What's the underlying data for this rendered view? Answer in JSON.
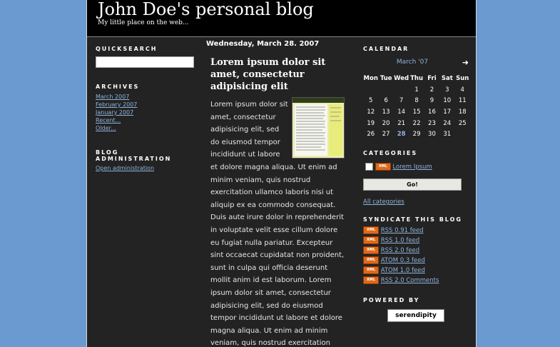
{
  "header": {
    "title": "John Doe's personal blog",
    "description": "My little place on the web..."
  },
  "left": {
    "quicksearch_title": "QUICKSEARCH",
    "archives_title": "ARCHIVES",
    "archives": [
      "March 2007",
      "February 2007",
      "January 2007",
      "Recent...",
      "Older..."
    ],
    "admin_title": "BLOG ADMINISTRATION",
    "admin_link": "Open administration"
  },
  "entry": {
    "date": "Wednesday, March 28. 2007",
    "title": "Lorem ipsum dolor sit amet, consectetur adipisicing elit",
    "body": "Lorem ipsum dolor sit amet, consectetur adipisicing elit, sed do eiusmod tempor incididunt ut labore et dolore magna aliqua. Ut enim ad minim veniam, quis nostrud exercitation ullamco laboris nisi ut aliquip ex ea commodo consequat. Duis aute irure dolor in reprehenderit in voluptate velit esse cillum dolore eu fugiat nulla pariatur. Excepteur sint occaecat cupidatat non proident, sunt in culpa qui officia deserunt mollit anim id est laborum. Lorem ipsum dolor sit amet, consectetur adipisicing elit, sed do eiusmod tempor incididunt ut labore et dolore magna aliqua. Ut enim ad minim veniam, quis nostrud exercitation ullamco laboris nisi ut aliquip ex ea"
  },
  "calendar": {
    "title": "CALENDAR",
    "month": "March '07",
    "next": "➜",
    "days": [
      "Mon",
      "Tue",
      "Wed",
      "Thu",
      "Fri",
      "Sat",
      "Sun"
    ],
    "weeks": [
      [
        "",
        "",
        "",
        "1",
        "2",
        "3",
        "4"
      ],
      [
        "5",
        "6",
        "7",
        "8",
        "9",
        "10",
        "11"
      ],
      [
        "12",
        "13",
        "14",
        "15",
        "16",
        "17",
        "18"
      ],
      [
        "19",
        "20",
        "21",
        "22",
        "23",
        "24",
        "25"
      ],
      [
        "26",
        "27",
        "28",
        "29",
        "30",
        "31",
        ""
      ]
    ],
    "today": "28"
  },
  "categories": {
    "title": "CATEGORIES",
    "items": [
      "Lorem Ipsum"
    ],
    "go_label": "Go!",
    "all_link": "All categories"
  },
  "syndicate": {
    "title": "SYNDICATE THIS BLOG",
    "badge": "XML",
    "items": [
      "RSS 0.91 feed",
      "RSS 1.0 feed",
      "RSS 2.0 feed",
      "ATOM 0.3 feed",
      "ATOM 1.0 feed",
      "RSS 2.0 Comments"
    ]
  },
  "powered": {
    "title": "POWERED BY",
    "badge_text": "serendipity"
  }
}
